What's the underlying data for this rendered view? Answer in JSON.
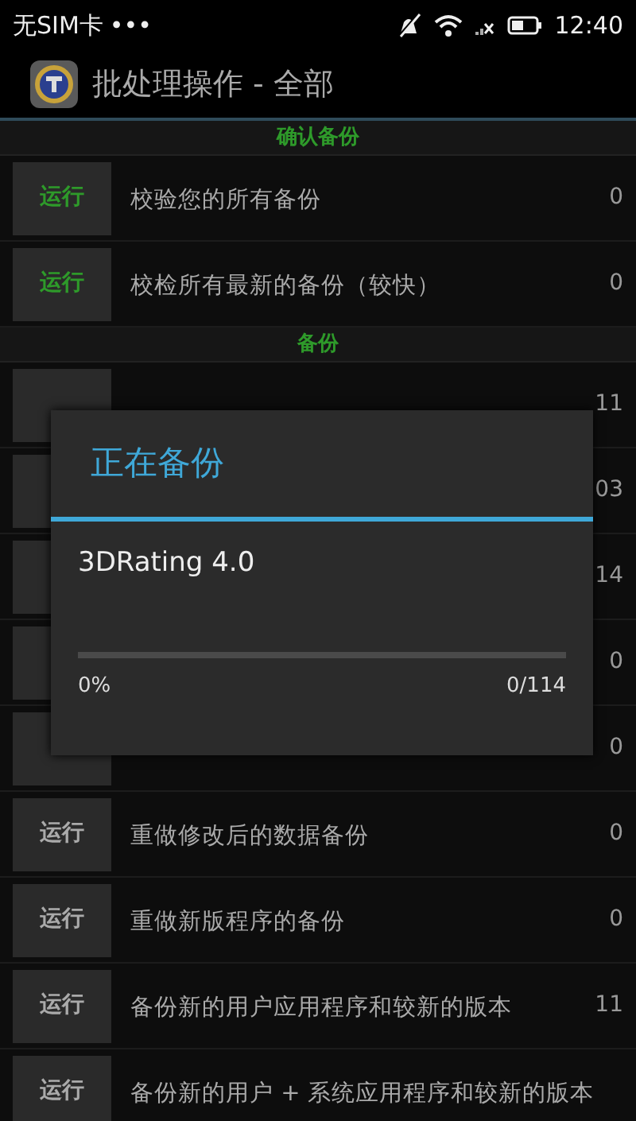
{
  "status_bar": {
    "carrier": "无SIM卡",
    "dots": "•••",
    "time": "12:40"
  },
  "action_bar": {
    "title": "批处理操作 - 全部"
  },
  "sections": [
    {
      "title": "确认备份",
      "items": [
        {
          "button": "运行",
          "label": "校验您的所有备份",
          "count": "0",
          "highlight": true
        },
        {
          "button": "运行",
          "label": "校检所有最新的备份（较快）",
          "count": "0",
          "highlight": true
        }
      ]
    },
    {
      "title": "备份",
      "items": [
        {
          "count": "11"
        },
        {
          "count": "03"
        },
        {
          "count": "14"
        },
        {
          "count": "0"
        },
        {
          "count": "0"
        },
        {
          "button": "运行",
          "label": "重做修改后的数据备份",
          "count": "0",
          "highlight": false
        },
        {
          "button": "运行",
          "label": "重做新版程序的备份",
          "count": "0",
          "highlight": false
        },
        {
          "button": "运行",
          "label": "备份新的用户应用程序和较新的版本",
          "count": "11",
          "highlight": false
        },
        {
          "button": "运行",
          "label": "备份新的用户 + 系统应用程序和较新的版本",
          "highlight": false
        }
      ]
    }
  ],
  "dialog": {
    "title": "正在备份",
    "message": "3DRating 4.0",
    "level": 0,
    "percent": "0%",
    "progress": "0/114"
  }
}
